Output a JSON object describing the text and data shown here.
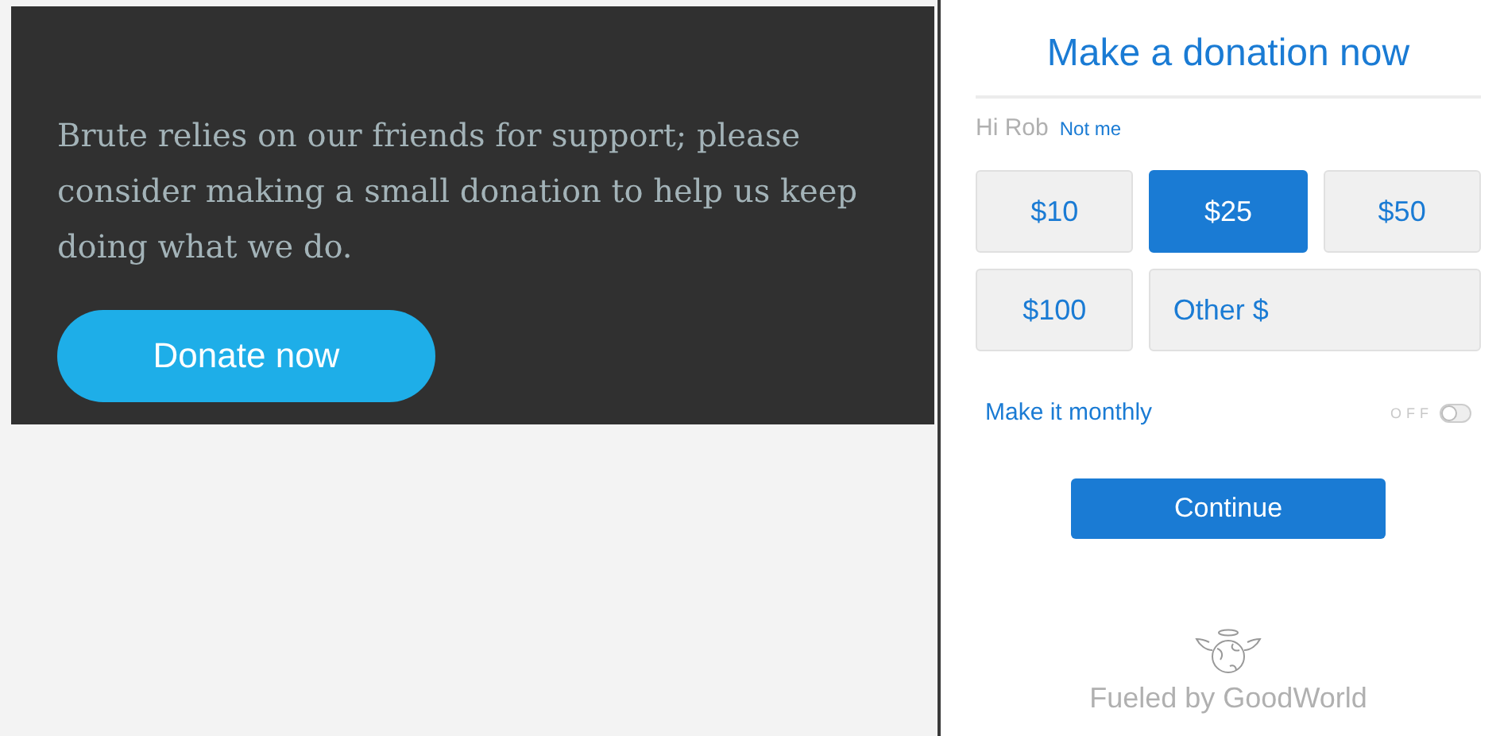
{
  "promo": {
    "message": "Brute relies on our friends for support; please consider making a small donation to help us keep doing what we do.",
    "button": "Donate now"
  },
  "donation_form": {
    "title": "Make a donation now",
    "greeting": "Hi Rob",
    "not_me_link": "Not me",
    "amounts": [
      {
        "label": "$10",
        "selected": false
      },
      {
        "label": "$25",
        "selected": true
      },
      {
        "label": "$50",
        "selected": false
      },
      {
        "label": "$100",
        "selected": false
      }
    ],
    "other_amount": {
      "placeholder": "Other $"
    },
    "monthly": {
      "label": "Make it monthly",
      "toggle_text": "OFF",
      "on": false
    },
    "continue_button": "Continue",
    "footer": "Fueled by GoodWorld"
  }
}
